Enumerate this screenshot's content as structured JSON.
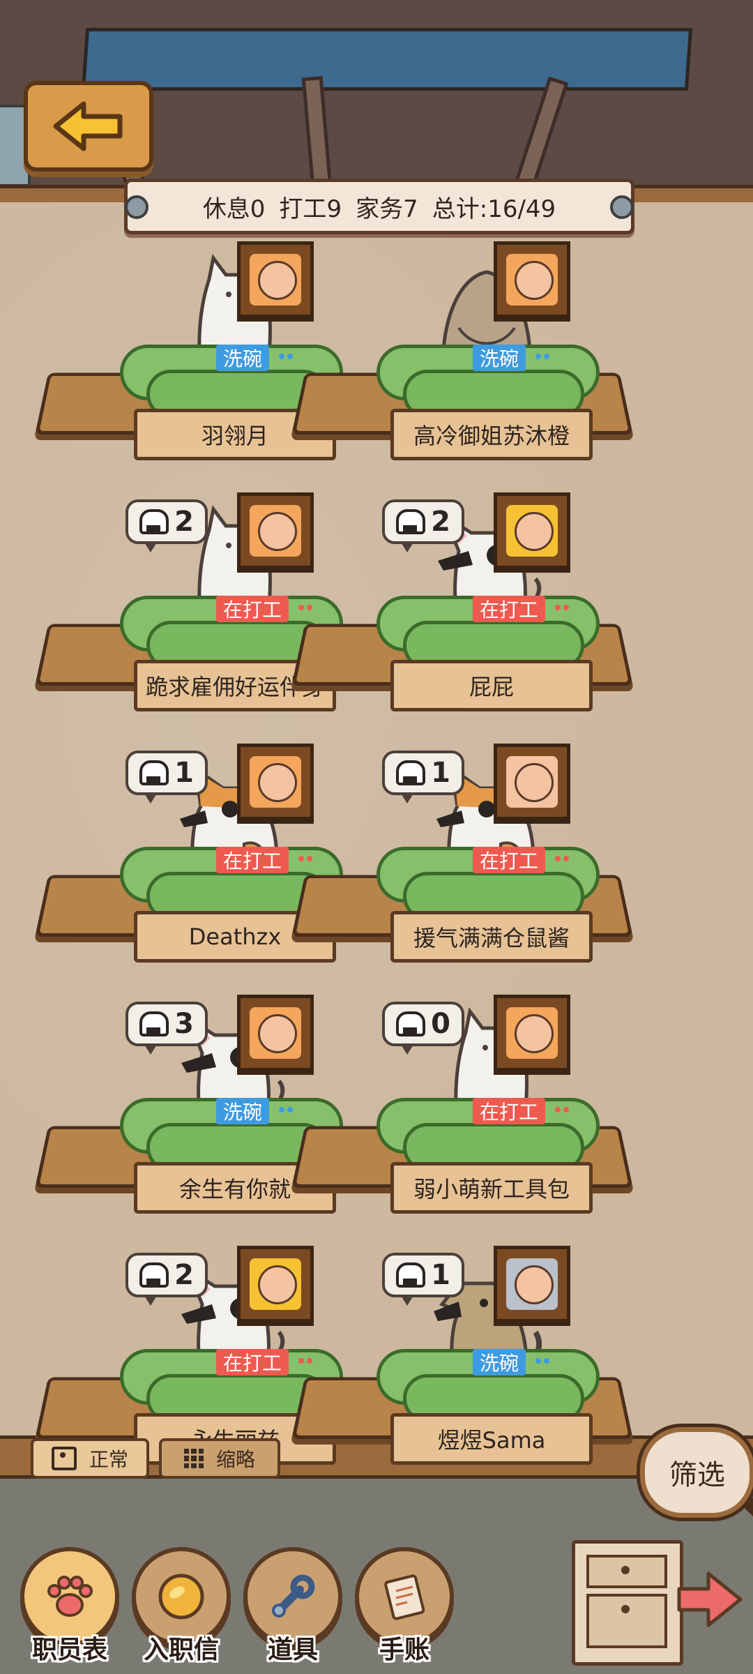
{
  "stats": {
    "rest": "休息0",
    "work": "打工9",
    "chores": "家务7",
    "total": "总计:16/49"
  },
  "staff": [
    {
      "name": "羽翎月",
      "animal": "cat",
      "status": "洗碗",
      "status_type": "dishes",
      "count": "",
      "show_bubble": false,
      "portrait": "hamster-portrait"
    },
    {
      "name": "高冷御姐苏沐橙",
      "animal": "owl",
      "status": "洗碗",
      "status_type": "dishes",
      "count": "",
      "show_bubble": false,
      "portrait": "hamster-portrait"
    },
    {
      "name": "跪求雇佣好运伴身",
      "animal": "cat",
      "status": "在打工",
      "status_type": "work",
      "count": "2",
      "show_bubble": true,
      "portrait": "hamster-portrait"
    },
    {
      "name": "屁屁",
      "animal": "dog-white",
      "status": "在打工",
      "status_type": "work",
      "count": "2",
      "show_bubble": true,
      "portrait": "excited-portrait"
    },
    {
      "name": "Deathzx",
      "animal": "corgi",
      "status": "在打工",
      "status_type": "work",
      "count": "1",
      "show_bubble": true,
      "portrait": "hamster-portrait"
    },
    {
      "name": "援气满满仓鼠酱",
      "animal": "corgi",
      "status": "在打工",
      "status_type": "work",
      "count": "1",
      "show_bubble": true,
      "portrait": "grandpa-portrait"
    },
    {
      "name": "余生有你就",
      "animal": "dog-white",
      "status": "洗碗",
      "status_type": "dishes",
      "count": "3",
      "show_bubble": true,
      "portrait": "hamster-portrait"
    },
    {
      "name": "弱小萌新工具包",
      "animal": "cat",
      "status": "在打工",
      "status_type": "work",
      "count": "0",
      "show_bubble": true,
      "portrait": "hamster-portrait"
    },
    {
      "name": "永生丽兹",
      "animal": "dog-white",
      "status": "在打工",
      "status_type": "work",
      "count": "2",
      "show_bubble": true,
      "portrait": "excited-portrait"
    },
    {
      "name": "煜煜Sama",
      "animal": "dog-brown",
      "status": "洗碗",
      "status_type": "dishes",
      "count": "1",
      "show_bubble": true,
      "portrait": "fish-hat-portrait"
    }
  ],
  "view": {
    "normal_label": "正常",
    "compact_label": "缩略"
  },
  "filter_label": "筛选",
  "nav": [
    {
      "label": "职员表",
      "icon": "paw-icon"
    },
    {
      "label": "入职信",
      "icon": "coin-icon"
    },
    {
      "label": "道具",
      "icon": "wrench-icon"
    },
    {
      "label": "手账",
      "icon": "notebook-icon"
    }
  ],
  "colors": {
    "dishes": "#3f9be0",
    "work": "#ee5a4f",
    "plate": "#e7c295",
    "wood": "#b98449"
  }
}
